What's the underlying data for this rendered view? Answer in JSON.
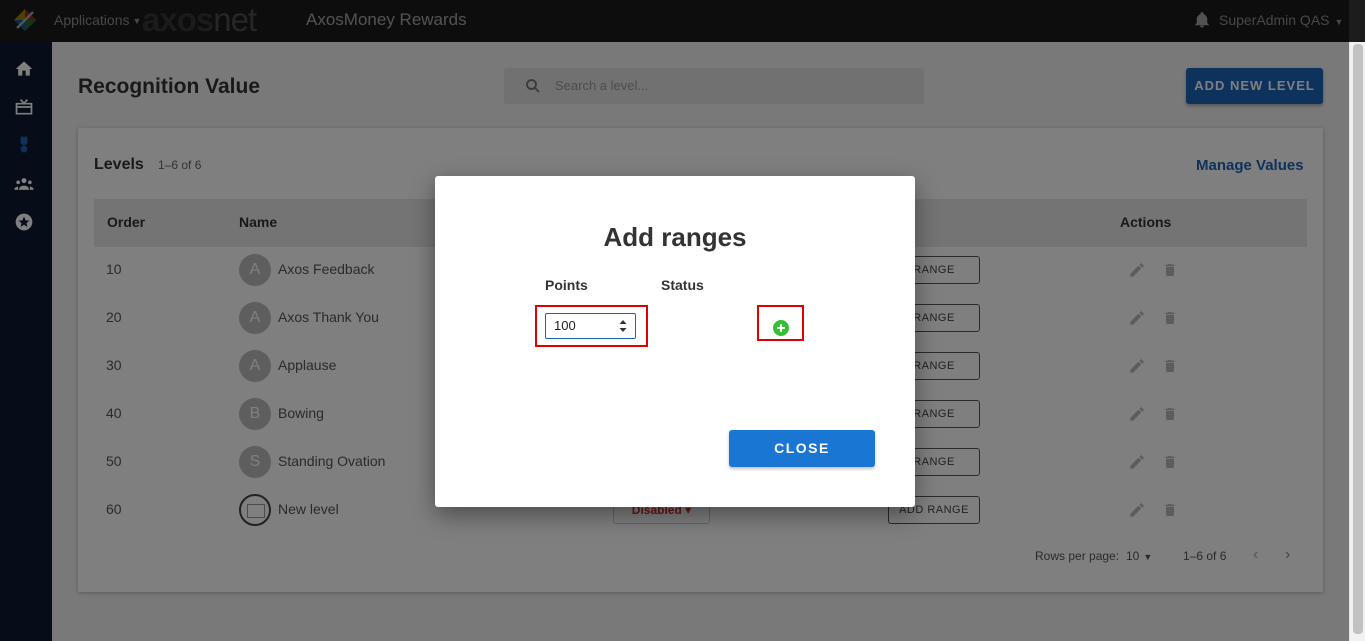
{
  "topbar": {
    "applications_label": "Applications",
    "brand_main": "axos",
    "brand_suffix": "net",
    "app_title": "AxosMoney Rewards",
    "user_name": "SuperAdmin QAS"
  },
  "sidebar": {
    "items": [
      {
        "icon": "home-icon"
      },
      {
        "icon": "gift-card-icon"
      },
      {
        "icon": "medal-icon",
        "active": true
      },
      {
        "icon": "people-icon"
      },
      {
        "icon": "star-badge-icon"
      }
    ]
  },
  "page": {
    "title": "Recognition Value",
    "search_placeholder": "Search a level...",
    "add_level_label": "ADD NEW LEVEL"
  },
  "levels": {
    "title": "Levels",
    "count": "1–6 of 6",
    "manage_label": "Manage Values",
    "columns": [
      "Order",
      "Name",
      "Actions"
    ],
    "rows": [
      {
        "order": "10",
        "initial": "A",
        "name": "Axos Feedback",
        "range_label": "RANGE"
      },
      {
        "order": "20",
        "initial": "A",
        "name": "Axos Thank You",
        "range_label": "RANGE"
      },
      {
        "order": "30",
        "initial": "A",
        "name": "Applause",
        "range_label": "RANGE"
      },
      {
        "order": "40",
        "initial": "B",
        "name": "Bowing",
        "range_label": "RANGE"
      },
      {
        "order": "50",
        "initial": "S",
        "name": "Standing Ovation",
        "range_label": "RANGE"
      },
      {
        "order": "60",
        "initial": "",
        "name": "New level",
        "status": "Disabled",
        "range_label": "ADD RANGE"
      }
    ],
    "footer": {
      "rows_per_page_label": "Rows per page:",
      "rows_per_page_value": "10",
      "page_count": "1–6 of 6"
    }
  },
  "dialog": {
    "title": "Add ranges",
    "points_header": "Points",
    "status_header": "Status",
    "points_value": "100",
    "close_label": "CLOSE"
  },
  "colors": {
    "topbar": "#2b2b2b",
    "sidebar": "#0d1a33",
    "primary": "#1b64b8",
    "highlight": "#e00000",
    "add_green": "#33c133",
    "disabled_red": "#d32f2f"
  }
}
